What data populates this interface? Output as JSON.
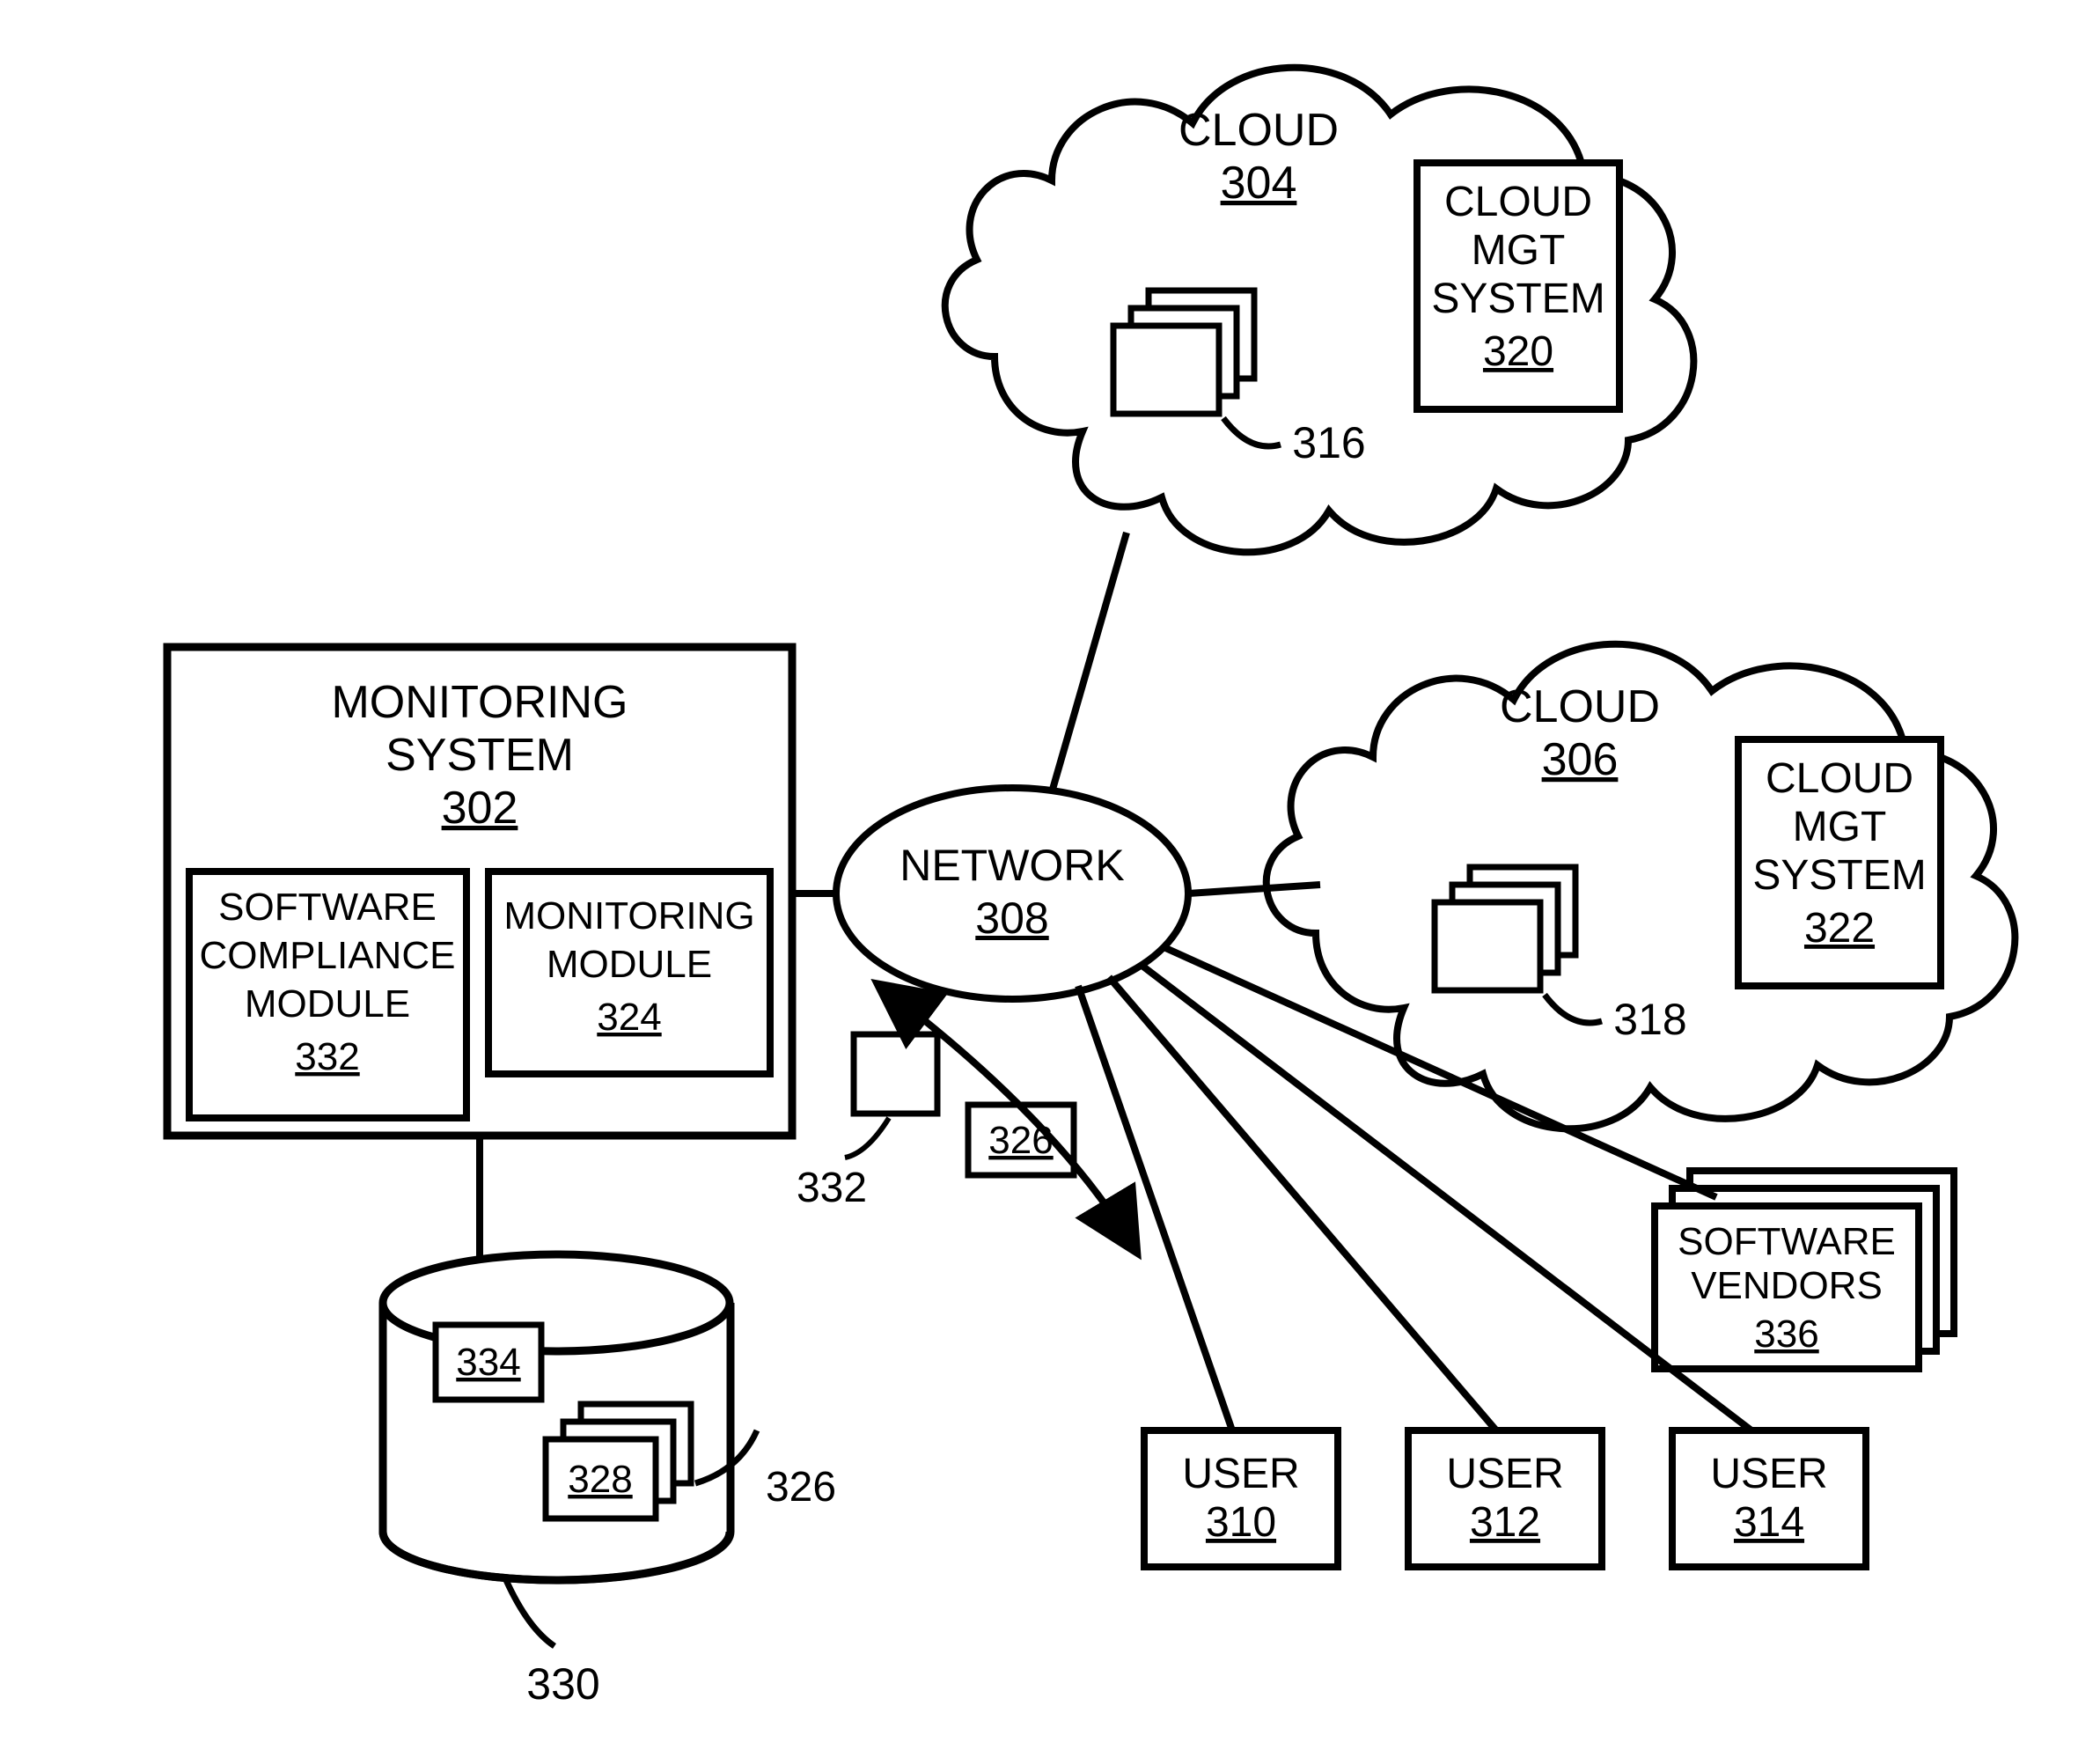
{
  "cloud1": {
    "title": "CLOUD",
    "ref": "304",
    "vm_ref": "316",
    "mgt": {
      "l1": "CLOUD",
      "l2": "MGT",
      "l3": "SYSTEM",
      "ref": "320"
    }
  },
  "cloud2": {
    "title": "CLOUD",
    "ref": "306",
    "vm_ref": "318",
    "mgt": {
      "l1": "CLOUD",
      "l2": "MGT",
      "l3": "SYSTEM",
      "ref": "322"
    }
  },
  "network": {
    "title": "NETWORK",
    "ref": "308"
  },
  "monitor": {
    "l1": "MONITORING",
    "l2": "SYSTEM",
    "ref": "302",
    "modA": {
      "l1": "SOFTWARE",
      "l2": "COMPLIANCE",
      "l3": "MODULE",
      "ref": "332"
    },
    "modB": {
      "l1": "MONITORING",
      "l2": "MODULE",
      "ref": "324"
    }
  },
  "float": {
    "ref332": "332",
    "ref326": "326"
  },
  "db": {
    "ref334": "334",
    "ref328": "328",
    "leader326": "326",
    "ref330": "330"
  },
  "vendors": {
    "l1": "SOFTWARE",
    "l2": "VENDORS",
    "ref": "336"
  },
  "users": {
    "u1": {
      "label": "USER",
      "ref": "310"
    },
    "u2": {
      "label": "USER",
      "ref": "312"
    },
    "u3": {
      "label": "USER",
      "ref": "314"
    }
  }
}
